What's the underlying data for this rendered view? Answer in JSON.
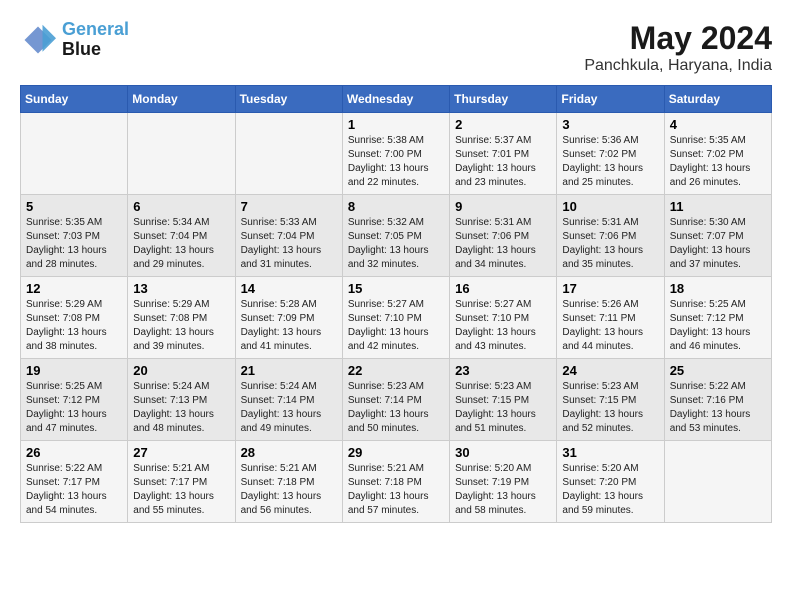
{
  "logo": {
    "line1": "General",
    "line2": "Blue"
  },
  "title": "May 2024",
  "subtitle": "Panchkula, Haryana, India",
  "headers": [
    "Sunday",
    "Monday",
    "Tuesday",
    "Wednesday",
    "Thursday",
    "Friday",
    "Saturday"
  ],
  "weeks": [
    [
      {
        "day": "",
        "info": ""
      },
      {
        "day": "",
        "info": ""
      },
      {
        "day": "",
        "info": ""
      },
      {
        "day": "1",
        "info": "Sunrise: 5:38 AM\nSunset: 7:00 PM\nDaylight: 13 hours\nand 22 minutes."
      },
      {
        "day": "2",
        "info": "Sunrise: 5:37 AM\nSunset: 7:01 PM\nDaylight: 13 hours\nand 23 minutes."
      },
      {
        "day": "3",
        "info": "Sunrise: 5:36 AM\nSunset: 7:02 PM\nDaylight: 13 hours\nand 25 minutes."
      },
      {
        "day": "4",
        "info": "Sunrise: 5:35 AM\nSunset: 7:02 PM\nDaylight: 13 hours\nand 26 minutes."
      }
    ],
    [
      {
        "day": "5",
        "info": "Sunrise: 5:35 AM\nSunset: 7:03 PM\nDaylight: 13 hours\nand 28 minutes."
      },
      {
        "day": "6",
        "info": "Sunrise: 5:34 AM\nSunset: 7:04 PM\nDaylight: 13 hours\nand 29 minutes."
      },
      {
        "day": "7",
        "info": "Sunrise: 5:33 AM\nSunset: 7:04 PM\nDaylight: 13 hours\nand 31 minutes."
      },
      {
        "day": "8",
        "info": "Sunrise: 5:32 AM\nSunset: 7:05 PM\nDaylight: 13 hours\nand 32 minutes."
      },
      {
        "day": "9",
        "info": "Sunrise: 5:31 AM\nSunset: 7:06 PM\nDaylight: 13 hours\nand 34 minutes."
      },
      {
        "day": "10",
        "info": "Sunrise: 5:31 AM\nSunset: 7:06 PM\nDaylight: 13 hours\nand 35 minutes."
      },
      {
        "day": "11",
        "info": "Sunrise: 5:30 AM\nSunset: 7:07 PM\nDaylight: 13 hours\nand 37 minutes."
      }
    ],
    [
      {
        "day": "12",
        "info": "Sunrise: 5:29 AM\nSunset: 7:08 PM\nDaylight: 13 hours\nand 38 minutes."
      },
      {
        "day": "13",
        "info": "Sunrise: 5:29 AM\nSunset: 7:08 PM\nDaylight: 13 hours\nand 39 minutes."
      },
      {
        "day": "14",
        "info": "Sunrise: 5:28 AM\nSunset: 7:09 PM\nDaylight: 13 hours\nand 41 minutes."
      },
      {
        "day": "15",
        "info": "Sunrise: 5:27 AM\nSunset: 7:10 PM\nDaylight: 13 hours\nand 42 minutes."
      },
      {
        "day": "16",
        "info": "Sunrise: 5:27 AM\nSunset: 7:10 PM\nDaylight: 13 hours\nand 43 minutes."
      },
      {
        "day": "17",
        "info": "Sunrise: 5:26 AM\nSunset: 7:11 PM\nDaylight: 13 hours\nand 44 minutes."
      },
      {
        "day": "18",
        "info": "Sunrise: 5:25 AM\nSunset: 7:12 PM\nDaylight: 13 hours\nand 46 minutes."
      }
    ],
    [
      {
        "day": "19",
        "info": "Sunrise: 5:25 AM\nSunset: 7:12 PM\nDaylight: 13 hours\nand 47 minutes."
      },
      {
        "day": "20",
        "info": "Sunrise: 5:24 AM\nSunset: 7:13 PM\nDaylight: 13 hours\nand 48 minutes."
      },
      {
        "day": "21",
        "info": "Sunrise: 5:24 AM\nSunset: 7:14 PM\nDaylight: 13 hours\nand 49 minutes."
      },
      {
        "day": "22",
        "info": "Sunrise: 5:23 AM\nSunset: 7:14 PM\nDaylight: 13 hours\nand 50 minutes."
      },
      {
        "day": "23",
        "info": "Sunrise: 5:23 AM\nSunset: 7:15 PM\nDaylight: 13 hours\nand 51 minutes."
      },
      {
        "day": "24",
        "info": "Sunrise: 5:23 AM\nSunset: 7:15 PM\nDaylight: 13 hours\nand 52 minutes."
      },
      {
        "day": "25",
        "info": "Sunrise: 5:22 AM\nSunset: 7:16 PM\nDaylight: 13 hours\nand 53 minutes."
      }
    ],
    [
      {
        "day": "26",
        "info": "Sunrise: 5:22 AM\nSunset: 7:17 PM\nDaylight: 13 hours\nand 54 minutes."
      },
      {
        "day": "27",
        "info": "Sunrise: 5:21 AM\nSunset: 7:17 PM\nDaylight: 13 hours\nand 55 minutes."
      },
      {
        "day": "28",
        "info": "Sunrise: 5:21 AM\nSunset: 7:18 PM\nDaylight: 13 hours\nand 56 minutes."
      },
      {
        "day": "29",
        "info": "Sunrise: 5:21 AM\nSunset: 7:18 PM\nDaylight: 13 hours\nand 57 minutes."
      },
      {
        "day": "30",
        "info": "Sunrise: 5:20 AM\nSunset: 7:19 PM\nDaylight: 13 hours\nand 58 minutes."
      },
      {
        "day": "31",
        "info": "Sunrise: 5:20 AM\nSunset: 7:20 PM\nDaylight: 13 hours\nand 59 minutes."
      },
      {
        "day": "",
        "info": ""
      }
    ]
  ]
}
